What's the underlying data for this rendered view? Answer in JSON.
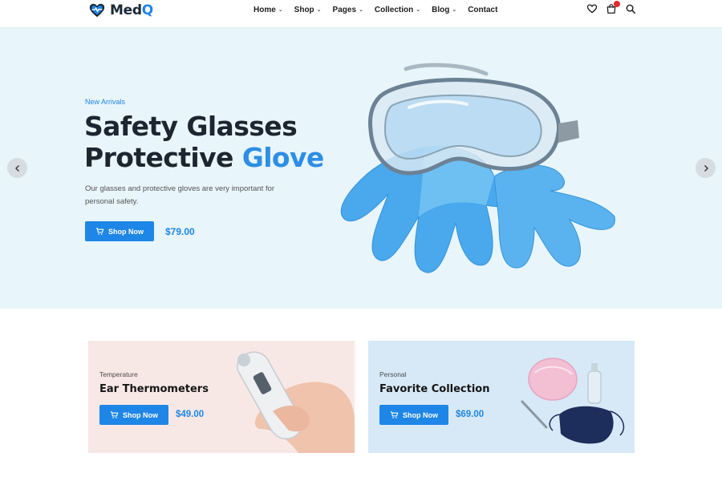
{
  "brand": {
    "name_main": "Med",
    "name_accent": "Q",
    "logo_icon": "heart-pulse-icon"
  },
  "nav": {
    "items": [
      {
        "label": "Home",
        "has_dropdown": true
      },
      {
        "label": "Shop",
        "has_dropdown": true
      },
      {
        "label": "Pages",
        "has_dropdown": true
      },
      {
        "label": "Collection",
        "has_dropdown": true
      },
      {
        "label": "Blog",
        "has_dropdown": true
      },
      {
        "label": "Contact",
        "has_dropdown": false
      }
    ],
    "icons": [
      "heart-icon",
      "cart-icon",
      "search-icon"
    ]
  },
  "hero": {
    "eyebrow": "New Arrivals",
    "title_line1": "Safety Glasses",
    "title_line2_main": "Protective ",
    "title_line2_accent": "Glove",
    "description": "Our glasses and protective gloves are very important for personal safety.",
    "button_label": "Shop Now",
    "price": "$79.00"
  },
  "cards": [
    {
      "eyebrow": "Temperature",
      "title": "Ear Thermometers",
      "button_label": "Shop Now",
      "price": "$49.00"
    },
    {
      "eyebrow": "Personal",
      "title": "Favorite Collection",
      "button_label": "Shop Now",
      "price": "$69.00"
    }
  ],
  "colors": {
    "accent": "#1e86e6",
    "hero_bg": "#e8f5fa",
    "card1_bg": "#f7e8e6",
    "card2_bg": "#d7e9f7",
    "badge": "#e52b2b"
  }
}
